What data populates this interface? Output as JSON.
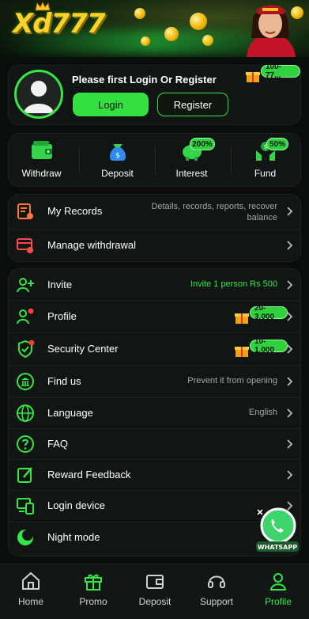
{
  "banner": {
    "logo_text": "Xd777"
  },
  "header": {
    "title": "Please first Login Or Register",
    "login_label": "Login",
    "register_label": "Register",
    "promo_badge": "100-77..."
  },
  "quick_actions": [
    {
      "label": "Withdraw",
      "icon": "wallet-icon"
    },
    {
      "label": "Deposit",
      "icon": "money-bag-icon"
    },
    {
      "label": "Interest",
      "icon": "piggy-bank-icon",
      "badge": "200%"
    },
    {
      "label": "Fund",
      "icon": "fund-hands-icon",
      "badge": "50%"
    }
  ],
  "records": [
    {
      "label": "My Records",
      "detail": "Details, records, reports, recover balance",
      "icon": "records-icon"
    },
    {
      "label": "Manage withdrawal",
      "detail": "",
      "icon": "card-settings-icon"
    }
  ],
  "menu": [
    {
      "label": "Invite",
      "detail": "Invite 1 person Rs 500",
      "icon": "add-user-icon"
    },
    {
      "label": "Profile",
      "badge": "20-3,000",
      "icon": "user-edit-icon"
    },
    {
      "label": "Security Center",
      "badge": "10-1,000",
      "icon": "shield-check-icon"
    },
    {
      "label": "Find us",
      "detail": "Prevent it from opening",
      "icon": "bank-icon"
    },
    {
      "label": "Language",
      "detail": "English",
      "icon": "globe-icon"
    },
    {
      "label": "FAQ",
      "detail": "",
      "icon": "question-icon"
    },
    {
      "label": "Reward Feedback",
      "detail": "",
      "icon": "feedback-icon"
    },
    {
      "label": "Login device",
      "detail": "",
      "icon": "devices-icon"
    },
    {
      "label": "Night mode",
      "detail": "",
      "icon": "moon-icon"
    }
  ],
  "whatsapp": {
    "label": "WHATSAPP"
  },
  "nav": [
    {
      "label": "Home",
      "icon": "home-icon"
    },
    {
      "label": "Promo",
      "icon": "gift-icon"
    },
    {
      "label": "Deposit",
      "icon": "wallet-icon"
    },
    {
      "label": "Support",
      "icon": "headset-icon"
    },
    {
      "label": "Profile",
      "icon": "user-icon",
      "active": true
    }
  ],
  "colors": {
    "accent": "#35e845",
    "background": "#0b0d0c",
    "card": "#111513",
    "alert": "#ff3b3b"
  }
}
